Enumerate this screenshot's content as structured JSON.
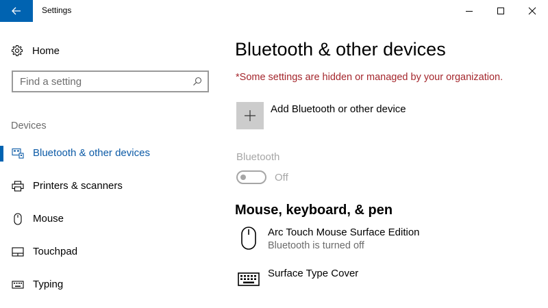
{
  "window": {
    "title": "Settings"
  },
  "sidebar": {
    "home_label": "Home",
    "search_placeholder": "Find a setting",
    "section_label": "Devices",
    "items": [
      {
        "label": "Bluetooth & other devices",
        "icon": "bluetooth-devices-icon",
        "active": true
      },
      {
        "label": "Printers & scanners",
        "icon": "printer-icon",
        "active": false
      },
      {
        "label": "Mouse",
        "icon": "mouse-icon",
        "active": false
      },
      {
        "label": "Touchpad",
        "icon": "touchpad-icon",
        "active": false
      },
      {
        "label": "Typing",
        "icon": "keyboard-icon",
        "active": false
      }
    ]
  },
  "main": {
    "title": "Bluetooth & other devices",
    "org_notice": "*Some settings are hidden or managed by your organization.",
    "add_device_label": "Add Bluetooth or other device",
    "bluetooth_label": "Bluetooth",
    "bluetooth_state": "Off",
    "section_heading": "Mouse, keyboard, & pen",
    "devices": [
      {
        "name": "Arc Touch Mouse Surface Edition",
        "status": "Bluetooth is turned off",
        "icon": "mouse-icon"
      },
      {
        "name": "Surface Type Cover",
        "status": "",
        "icon": "keyboard-icon"
      }
    ]
  },
  "colors": {
    "accent": "#0063b1",
    "active_text": "#0b5aa6",
    "notice": "#a4262c",
    "disabled": "#a6a6a6",
    "secondary_text": "#6b6b6b"
  }
}
